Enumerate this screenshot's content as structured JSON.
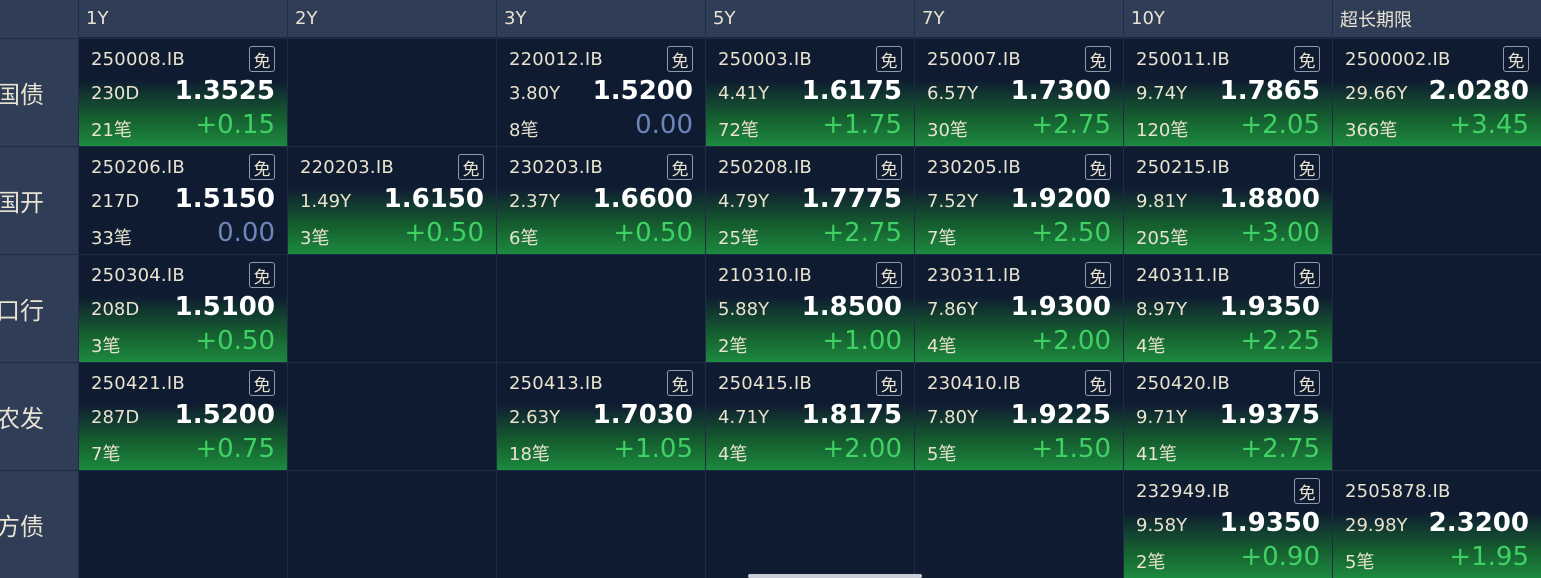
{
  "columns": [
    "1Y",
    "2Y",
    "3Y",
    "5Y",
    "7Y",
    "10Y",
    "超长期限"
  ],
  "rows": [
    {
      "label": "国债",
      "cells": [
        {
          "code": "250008.IB",
          "free": "免",
          "term": "230D",
          "yield": "1.3525",
          "count": "21笔",
          "change": "+0.15",
          "flat": false
        },
        null,
        {
          "code": "220012.IB",
          "free": "免",
          "term": "3.80Y",
          "yield": "1.5200",
          "count": "8笔",
          "change": "0.00",
          "flat": true
        },
        {
          "code": "250003.IB",
          "free": "免",
          "term": "4.41Y",
          "yield": "1.6175",
          "count": "72笔",
          "change": "+1.75",
          "flat": false
        },
        {
          "code": "250007.IB",
          "free": "免",
          "term": "6.57Y",
          "yield": "1.7300",
          "count": "30笔",
          "change": "+2.75",
          "flat": false
        },
        {
          "code": "250011.IB",
          "free": "免",
          "term": "9.74Y",
          "yield": "1.7865",
          "count": "120笔",
          "change": "+2.05",
          "flat": false
        },
        {
          "code": "2500002.IB",
          "free": "免",
          "term": "29.66Y",
          "yield": "2.0280",
          "count": "366笔",
          "change": "+3.45",
          "flat": false
        }
      ]
    },
    {
      "label": "国开",
      "cells": [
        {
          "code": "250206.IB",
          "free": "免",
          "term": "217D",
          "yield": "1.5150",
          "count": "33笔",
          "change": "0.00",
          "flat": true
        },
        {
          "code": "220203.IB",
          "free": "免",
          "term": "1.49Y",
          "yield": "1.6150",
          "count": "3笔",
          "change": "+0.50",
          "flat": false
        },
        {
          "code": "230203.IB",
          "free": "免",
          "term": "2.37Y",
          "yield": "1.6600",
          "count": "6笔",
          "change": "+0.50",
          "flat": false
        },
        {
          "code": "250208.IB",
          "free": "免",
          "term": "4.79Y",
          "yield": "1.7775",
          "count": "25笔",
          "change": "+2.75",
          "flat": false
        },
        {
          "code": "230205.IB",
          "free": "免",
          "term": "7.52Y",
          "yield": "1.9200",
          "count": "7笔",
          "change": "+2.50",
          "flat": false
        },
        {
          "code": "250215.IB",
          "free": "免",
          "term": "9.81Y",
          "yield": "1.8800",
          "count": "205笔",
          "change": "+3.00",
          "flat": false
        },
        null
      ]
    },
    {
      "label": "口行",
      "cells": [
        {
          "code": "250304.IB",
          "free": "免",
          "term": "208D",
          "yield": "1.5100",
          "count": "3笔",
          "change": "+0.50",
          "flat": false
        },
        null,
        null,
        {
          "code": "210310.IB",
          "free": "免",
          "term": "5.88Y",
          "yield": "1.8500",
          "count": "2笔",
          "change": "+1.00",
          "flat": false
        },
        {
          "code": "230311.IB",
          "free": "免",
          "term": "7.86Y",
          "yield": "1.9300",
          "count": "4笔",
          "change": "+2.00",
          "flat": false
        },
        {
          "code": "240311.IB",
          "free": "免",
          "term": "8.97Y",
          "yield": "1.9350",
          "count": "4笔",
          "change": "+2.25",
          "flat": false
        },
        null
      ]
    },
    {
      "label": "农发",
      "cells": [
        {
          "code": "250421.IB",
          "free": "免",
          "term": "287D",
          "yield": "1.5200",
          "count": "7笔",
          "change": "+0.75",
          "flat": false
        },
        null,
        {
          "code": "250413.IB",
          "free": "免",
          "term": "2.63Y",
          "yield": "1.7030",
          "count": "18笔",
          "change": "+1.05",
          "flat": false
        },
        {
          "code": "250415.IB",
          "free": "免",
          "term": "4.71Y",
          "yield": "1.8175",
          "count": "4笔",
          "change": "+2.00",
          "flat": false
        },
        {
          "code": "230410.IB",
          "free": "免",
          "term": "7.80Y",
          "yield": "1.9225",
          "count": "5笔",
          "change": "+1.50",
          "flat": false
        },
        {
          "code": "250420.IB",
          "free": "免",
          "term": "9.71Y",
          "yield": "1.9375",
          "count": "41笔",
          "change": "+2.75",
          "flat": false
        },
        null
      ]
    },
    {
      "label": "地方债",
      "cells": [
        null,
        null,
        null,
        null,
        null,
        {
          "code": "232949.IB",
          "free": "免",
          "term": "9.58Y",
          "yield": "1.9350",
          "count": "2笔",
          "change": "+0.90",
          "flat": false
        },
        {
          "code": "2505878.IB",
          "free": "",
          "term": "29.98Y",
          "yield": "2.3200",
          "count": "5笔",
          "change": "+1.95",
          "flat": false
        }
      ]
    }
  ],
  "colors": {
    "background": "#0f1b31",
    "header": "#2f3d57",
    "up": "#3fd164",
    "flat": "#6c86b8",
    "gradient_green": "#1c8a3e"
  }
}
